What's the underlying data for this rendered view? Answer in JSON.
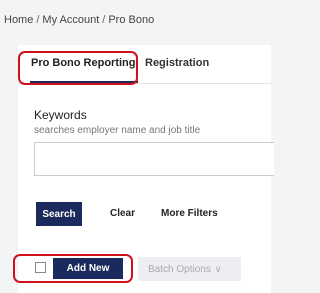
{
  "breadcrumb": {
    "items": [
      "Home",
      "My Account",
      "Pro Bono"
    ],
    "separator": "/"
  },
  "tabs": [
    {
      "label": "Pro Bono Reporting"
    },
    {
      "label": "Registration"
    }
  ],
  "search": {
    "keywords_label": "Keywords",
    "keywords_hint": "searches employer name and job title",
    "keywords_value": "",
    "search_label": "Search",
    "clear_label": "Clear",
    "more_filters_label": "More Filters"
  },
  "actions": {
    "add_new_label": "Add New",
    "batch_options_label": "Batch Options",
    "batch_options_icon": "chevron-down-icon"
  },
  "colors": {
    "primary": "#1b2a5c",
    "highlight": "#d0101a",
    "background": "#f3f4f6"
  }
}
